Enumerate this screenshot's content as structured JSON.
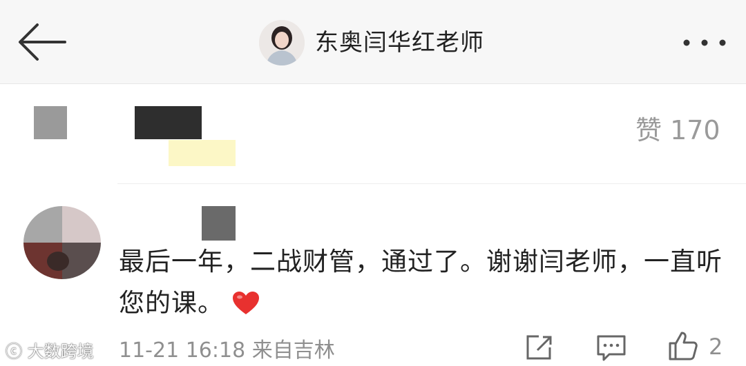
{
  "header": {
    "title": "东奥闫华红老师",
    "back_icon": "back-arrow-icon",
    "more_icon": "more-dots-icon"
  },
  "top_comment": {
    "like_label": "赞 170"
  },
  "comment": {
    "text": "最后一年，二战财管，通过了。谢谢闫老师，一直听您的课。",
    "emoji": "heart-icon",
    "meta": "11-21 16:18 来自吉林",
    "like_count": "2"
  },
  "watermark": "大数跨境",
  "colors": {
    "header_bg": "#f7f7f7",
    "text_primary": "#222222",
    "text_secondary": "#8f8f8f",
    "heart": "#e8312f"
  }
}
